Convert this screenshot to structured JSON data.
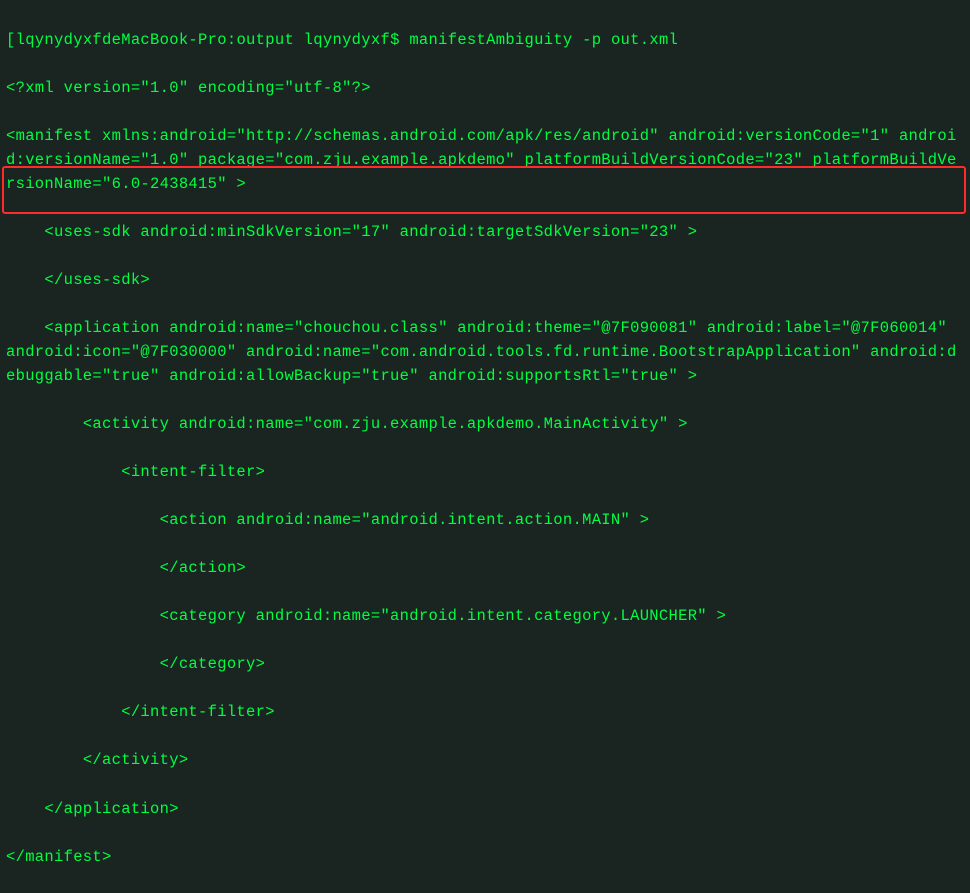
{
  "prompt": {
    "bracket_open": "[",
    "host": "lqynydyxfdeMacBook-Pro",
    "colon": ":",
    "path": "output",
    "user": "lqynydyxf",
    "dollar": "$",
    "bracket_close": "]"
  },
  "command": "manifestAmbiguity -p out.xml",
  "lines": {
    "l1": "<?xml version=\"1.0\" encoding=\"utf-8\"?>",
    "l2": "<manifest xmlns:android=\"http://schemas.android.com/apk/res/android\" android:versionCode=\"1\" android:versionName=\"1.0\" package=\"com.zju.example.apkdemo\" platformBuildVersionCode=\"23\" platformBuildVersionName=\"6.0-2438415\" >",
    "l3": "    <uses-sdk android:minSdkVersion=\"17\" android:targetSdkVersion=\"23\" >",
    "l4": "    </uses-sdk>",
    "l5": "    <application android:name=\"chouchou.class\" android:theme=\"@7F090081\" android:label=\"@7F060014\" android:icon=\"@7F030000\" android:name=\"com.android.tools.fd.runtime.BootstrapApplication\" android:debuggable=\"true\" android:allowBackup=\"true\" android:supportsRtl=\"true\" >",
    "l6": "        <activity android:name=\"com.zju.example.apkdemo.MainActivity\" >",
    "l7": "            <intent-filter>",
    "l8": "                <action android:name=\"android.intent.action.MAIN\" >",
    "l9": "                </action>",
    "l10": "                <category android:name=\"android.intent.category.LAUNCHER\" >",
    "l11": "                </category>",
    "l12": "            </intent-filter>",
    "l13": "        </activity>",
    "l14": "    </application>",
    "l15": "</manifest>"
  }
}
